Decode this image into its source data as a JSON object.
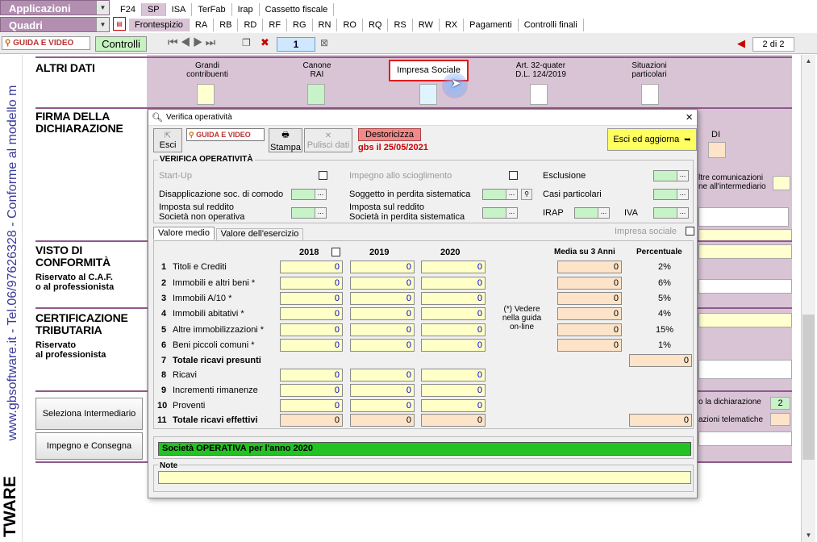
{
  "top": {
    "app_select": "Applicazioni",
    "quadri_select": "Quadri",
    "tabs_row1": [
      "F24",
      "SP",
      "ISA",
      "TerFab",
      "Irap",
      "Cassetto fiscale"
    ],
    "tabs_row2": [
      "Frontespizio",
      "RA",
      "RB",
      "RD",
      "RF",
      "RG",
      "RN",
      "RO",
      "RQ",
      "RS",
      "RW",
      "RX",
      "Pagamenti",
      "Controlli finali"
    ],
    "guida_label": "GUIDA E VIDEO",
    "controlli_label": "Controlli",
    "page_number": "1",
    "page_indicator": "2 di 2"
  },
  "side": {
    "vertical_text": "www.gbsoftware.it - Tel.06/97626328 - Conforme al modello m",
    "brand_bottom": "TWARE"
  },
  "altri_dati": {
    "title": "ALTRI DATI",
    "columns": [
      "Grandi\ncontribuenti",
      "Canone\nRAI",
      "Impresa Sociale",
      "Art. 32-quater\nD.L. 124/2019",
      "Situazioni\nparticolari"
    ]
  },
  "sections": {
    "firma": "FIRMA DELLA\nDICHIARAZIONE",
    "visto": "VISTO DI\nCONFORMITÀ",
    "visto_sub": "Riservato al C.A.F.\no al professionista",
    "cert": "CERTIFICAZIONE\nTRIBUTARIA",
    "cert_sub": "Riservato\nal professionista",
    "btn_intermediario": "Seleziona Intermediario",
    "btn_impegno": "Impegno e Consegna",
    "right_di": "DI",
    "right_comunic": "ltre comunicazioni\nne all'intermediario",
    "right_dichiarazione": "o la dichiarazione",
    "right_dichiarazione_val": "2",
    "right_telematiche": "azioni telematiche"
  },
  "dialog": {
    "title": "Verifica operatività",
    "esci": "Esci",
    "guida": "GUIDA E VIDEO",
    "stampa": "Stampa",
    "pulisci": "Pulisci dati",
    "destoricizza": "Destoricizza",
    "gbs_date": "gbs il 25/05/2021",
    "esci_aggiorna": "Esci ed aggiorna",
    "verifica_title": "VERIFICA OPERATIVITÀ",
    "startup": "Start-Up",
    "impegno_sciogl": "Impegno allo scioglimento",
    "esclusione": "Esclusione",
    "disappl": "Disapplicazione soc. di comodo",
    "soggetto_perdita": "Soggetto in perdita sistematica",
    "casi_particolari": "Casi particolari",
    "imposta_sno": "Imposta sul reddito\nSocietà non operativa",
    "imposta_sps": "Imposta sul reddito\nSocietà in perdita sistematica",
    "irap": "IRAP",
    "iva": "IVA",
    "tab_medio": "Valore medio",
    "tab_esercizio": "Valore dell'esercizio",
    "impresa_sociale": "Impresa sociale",
    "years": [
      "2018",
      "2019",
      "2020"
    ],
    "media_hdr": "Media su 3 Anni",
    "perc_hdr": "Percentuale",
    "rows_a": [
      {
        "n": "1",
        "label": "Titoli e Crediti",
        "v": [
          "0",
          "0",
          "0"
        ],
        "media": "0",
        "pct": "2%"
      },
      {
        "n": "2",
        "label": "Immobili e altri beni *",
        "v": [
          "0",
          "0",
          "0"
        ],
        "media": "0",
        "pct": "6%"
      },
      {
        "n": "3",
        "label": "Immobili A/10 *",
        "v": [
          "0",
          "0",
          "0"
        ],
        "media": "0",
        "pct": "5%"
      },
      {
        "n": "4",
        "label": "Immobili abitativi *",
        "v": [
          "0",
          "0",
          "0"
        ],
        "media": "0",
        "pct": "4%"
      },
      {
        "n": "5",
        "label": "Altre immobilizzazioni *",
        "v": [
          "0",
          "0",
          "0"
        ],
        "media": "0",
        "pct": "15%"
      },
      {
        "n": "6",
        "label": "Beni piccoli comuni *",
        "v": [
          "0",
          "0",
          "0"
        ],
        "media": "0",
        "pct": "1%"
      }
    ],
    "row7": {
      "n": "7",
      "label": "Totale ricavi presunti",
      "total": "0"
    },
    "rows_b": [
      {
        "n": "8",
        "label": "Ricavi",
        "v": [
          "0",
          "0",
          "0"
        ]
      },
      {
        "n": "9",
        "label": "Incrementi rimanenze",
        "v": [
          "0",
          "0",
          "0"
        ]
      },
      {
        "n": "10",
        "label": "Proventi",
        "v": [
          "0",
          "0",
          "0"
        ]
      }
    ],
    "row11": {
      "n": "11",
      "label": "Totale ricavi effettivi",
      "v": [
        "0",
        "0",
        "0"
      ],
      "total": "0"
    },
    "note_vedere": "(*) Vedere\nnella guida\non-line",
    "status": "Società OPERATIVA per l'anno 2020",
    "note_label": "Note"
  },
  "colors": {
    "pink_bg": "#d9c4d6",
    "accent": "#8f5a8c",
    "status_green": "#22c322"
  }
}
